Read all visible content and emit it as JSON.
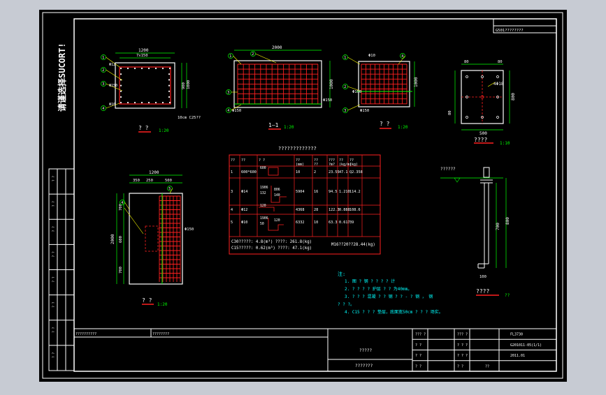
{
  "viewport": {
    "background": "#c7cbd3",
    "paper": "#000000"
  },
  "colors": {
    "frame": "#ffffff",
    "rebar": "#ff2020",
    "dim": "#00ff00",
    "note": "#00ffff",
    "text": "#ffffff",
    "leader": "#ffff00"
  },
  "side_label": "请谨选择SUCORT!",
  "top_code": "G501????????",
  "views": {
    "view1": {
      "title": "? ?",
      "scale": "1:20",
      "dims": {
        "overall": "1200",
        "spacing": "7x150",
        "height": "1000",
        "h_left": "900",
        "cover": "10cm C25??"
      },
      "bars": {
        "b1": "1",
        "b2": "2",
        "b3": "3",
        "b4": "4",
        "d1": "Φ12",
        "d2": "Φ10",
        "d3": "Φ12",
        "d4": "Φ150"
      }
    },
    "view2": {
      "title": "1—1",
      "scale": "1:20",
      "dims": {
        "overall": "2000",
        "height": "1000",
        "sp_left": "Φ150",
        "sp_right": "Φ150"
      },
      "bars": {
        "b1": "1",
        "b2": "2",
        "b3": "3",
        "b4": "4"
      }
    },
    "view3": {
      "title": "? ?",
      "scale": "1:20",
      "dims": {
        "height": "1000",
        "d_top": "Φ10",
        "sp": "Φ150",
        "sp2": "Φ150"
      },
      "bars": {
        "b1": "1",
        "b2": "2",
        "b3": "3",
        "b4": "4"
      }
    },
    "view4": {
      "title": "????",
      "scale": "1:10",
      "dims": {
        "w": "500",
        "h": "800",
        "t1": "80",
        "t2": "80",
        "t3": "80",
        "bolt": "4Φ18"
      }
    },
    "view5": {
      "title": "? ?",
      "scale": "1:20",
      "dims": {
        "overall": "1200",
        "a": "350",
        "b": "250",
        "c": "500",
        "h": "2000",
        "h1": "700",
        "h2": "600",
        "h3": "700",
        "sp": "Φ150",
        "sp2": "Φ150"
      },
      "bars": {
        "b5": "5",
        "b4": "4"
      }
    },
    "view6": {
      "title": "????",
      "scale": "??",
      "dims": {
        "h1": "700",
        "h2": "800",
        "bot": "100",
        "mark": "??????"
      }
    }
  },
  "rebar_table": {
    "title": "?????????????",
    "headers": [
      "??",
      "??",
      "? ?",
      "??\n(mm)",
      "??\n??",
      "???\n?m?",
      "??\n(kg/m)",
      "??\n(kg)"
    ],
    "rows": [
      {
        "no": "1",
        "dia": "600*600",
        "shape": "600",
        "len": "10",
        "cnt": "2",
        "total": "23.55",
        "unit": "47.1",
        "weight": "Q2.358"
      },
      {
        "no": "3",
        "dia": "Φ14",
        "shape": "1906|806|132|140",
        "len": "5904",
        "cnt": "16",
        "total": "94.5",
        "unit": "1.210",
        "weight": "114.2"
      },
      {
        "no": "4",
        "dia": "Φ12",
        "shape": "120",
        "len": "4368",
        "cnt": "28",
        "total": "122.3",
        "unit": "0.888",
        "weight": "108.6"
      },
      {
        "no": "5",
        "dia": "Φ10",
        "shape": "1906|120|50",
        "len": "6332",
        "cnt": "10",
        "total": "63.3",
        "unit": "0.617",
        "weight": "39"
      }
    ],
    "summary": [
      "C30?????:  4.8(m³)      ????:  261.8(kg)",
      "C15?????:  0.62(m³)     ????:  47.1(kg)",
      "M16??20??28.44(kg)"
    ]
  },
  "notes": {
    "heading": "注:",
    "lines": [
      "1. 图 ? 钢 ? ? ? ? 计",
      "2. ? ? ? ? 护层 ? ? 为40mm。",
      "3. ? ? ? 混凝 ? ? 钢 ? ? - ? 钢 ， 钢",
      "? ? ?。",
      "4. C15 ? ? ? 垫层，底面宽50cm ? ? ? 场实。"
    ]
  },
  "left_strip": [
    "? ?",
    "? ?",
    "? ?",
    "? ?",
    "? ?",
    "? ?",
    "? ?",
    "? ?"
  ],
  "title_block": {
    "left_cells": [
      "??????????",
      "????????"
    ],
    "center_top": "?????",
    "center_bottom": "???????",
    "rows": [
      {
        "a": "??? ?",
        "b": "",
        "c": "??? ?",
        "d": "FL3730"
      },
      {
        "a": "? ?",
        "b": "",
        "c": "? ? ?",
        "d": "G201011-05(1/1)"
      },
      {
        "a": "? ?",
        "b": "",
        "c": "? ? ?",
        "d": "2011.01"
      },
      {
        "a": "? ?",
        "b": "",
        "c": "? ?",
        "d": "??"
      }
    ]
  }
}
